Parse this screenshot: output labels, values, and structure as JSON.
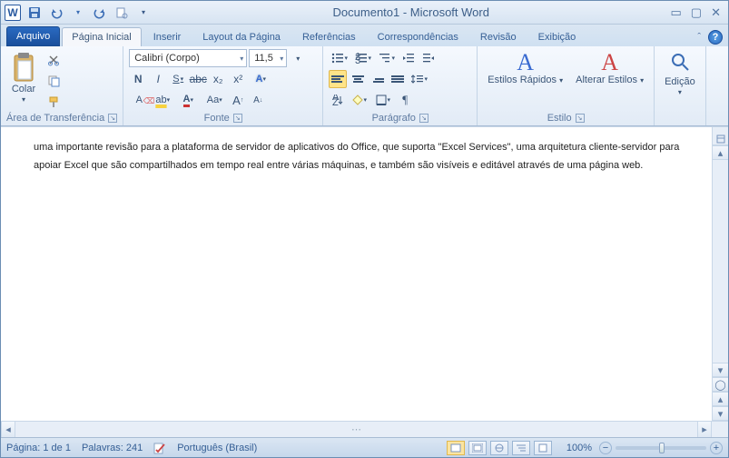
{
  "title": "Documento1 - Microsoft Word",
  "qat": {
    "word_letter": "W"
  },
  "tabs": {
    "file": "Arquivo",
    "items": [
      "Página Inicial",
      "Inserir",
      "Layout da Página",
      "Referências",
      "Correspondências",
      "Revisão",
      "Exibição"
    ],
    "active_index": 0
  },
  "ribbon": {
    "clipboard": {
      "label": "Área de Transferência",
      "paste": "Colar"
    },
    "font": {
      "label": "Fonte",
      "name": "Calibri (Corpo)",
      "size": "11,5",
      "bold": "N",
      "italic": "I",
      "underline": "S",
      "strike": "abc",
      "sub": "x₂",
      "sup": "x²",
      "grow": "A",
      "shrink": "A",
      "case": "Aa",
      "clear": "A"
    },
    "paragraph": {
      "label": "Parágrafo"
    },
    "styles": {
      "label": "Estilo",
      "quick": "Estilos Rápidos",
      "change": "Alterar Estilos"
    },
    "editing": {
      "label": "",
      "btn": "Edição"
    }
  },
  "document": {
    "paragraphs": [
      "uma importante revisão para a plataforma de servidor de aplicativos do Office, que suporta \"Excel Services\", uma arquitetura cliente-servidor para apoiar Excel que são compartilhados em tempo real entre várias máquinas, e também são visíveis e editável através de uma página web."
    ]
  },
  "status": {
    "page": "Página: 1 de 1",
    "words": "Palavras: 241",
    "lang": "Português (Brasil)",
    "zoom": "100%"
  }
}
